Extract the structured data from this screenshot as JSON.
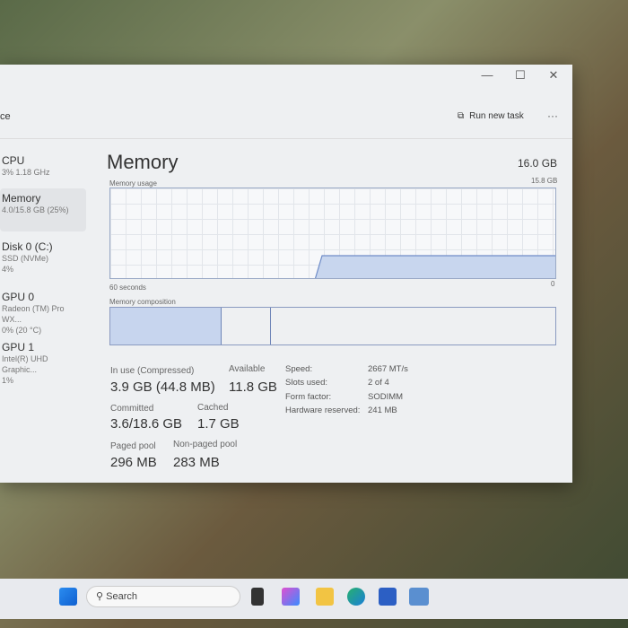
{
  "window": {
    "minimize": "—",
    "maximize": "☐",
    "close": "✕",
    "page_title_partial": "ce",
    "run_new_task": "Run new task",
    "more": "···"
  },
  "sidebar": [
    {
      "title": "CPU",
      "sub": "3%  1.18 GHz"
    },
    {
      "title": "Memory",
      "sub": "4.0/15.8 GB (25%)"
    },
    {
      "title": "Disk 0 (C:)",
      "sub": "SSD (NVMe)",
      "sub2": "4%"
    },
    {
      "title": "GPU 0",
      "sub": "Radeon (TM) Pro WX...",
      "sub2": "0% (20 °C)"
    },
    {
      "title": "GPU 1",
      "sub": "Intel(R) UHD Graphic...",
      "sub2": "1%"
    }
  ],
  "main": {
    "title": "Memory",
    "total": "16.0 GB",
    "usage_label": "Memory usage",
    "usage_max": "15.8 GB",
    "time_left": "60 seconds",
    "time_right": "0",
    "composition_label": "Memory composition",
    "composition": {
      "in_use_pct": 25,
      "modified_pct": 11
    }
  },
  "stats": {
    "in_use_label": "In use (Compressed)",
    "in_use": "3.9 GB (44.8 MB)",
    "available_label": "Available",
    "available": "11.8 GB",
    "committed_label": "Committed",
    "committed": "3.6/18.6 GB",
    "cached_label": "Cached",
    "cached": "1.7 GB",
    "paged_label": "Paged pool",
    "paged": "296 MB",
    "nonpaged_label": "Non-paged pool",
    "nonpaged": "283 MB"
  },
  "right": [
    {
      "k": "Speed:",
      "v": "2667 MT/s"
    },
    {
      "k": "Slots used:",
      "v": "2 of 4"
    },
    {
      "k": "Form factor:",
      "v": "SODIMM"
    },
    {
      "k": "Hardware reserved:",
      "v": "241 MB"
    }
  ],
  "taskbar": {
    "search": "Search"
  }
}
